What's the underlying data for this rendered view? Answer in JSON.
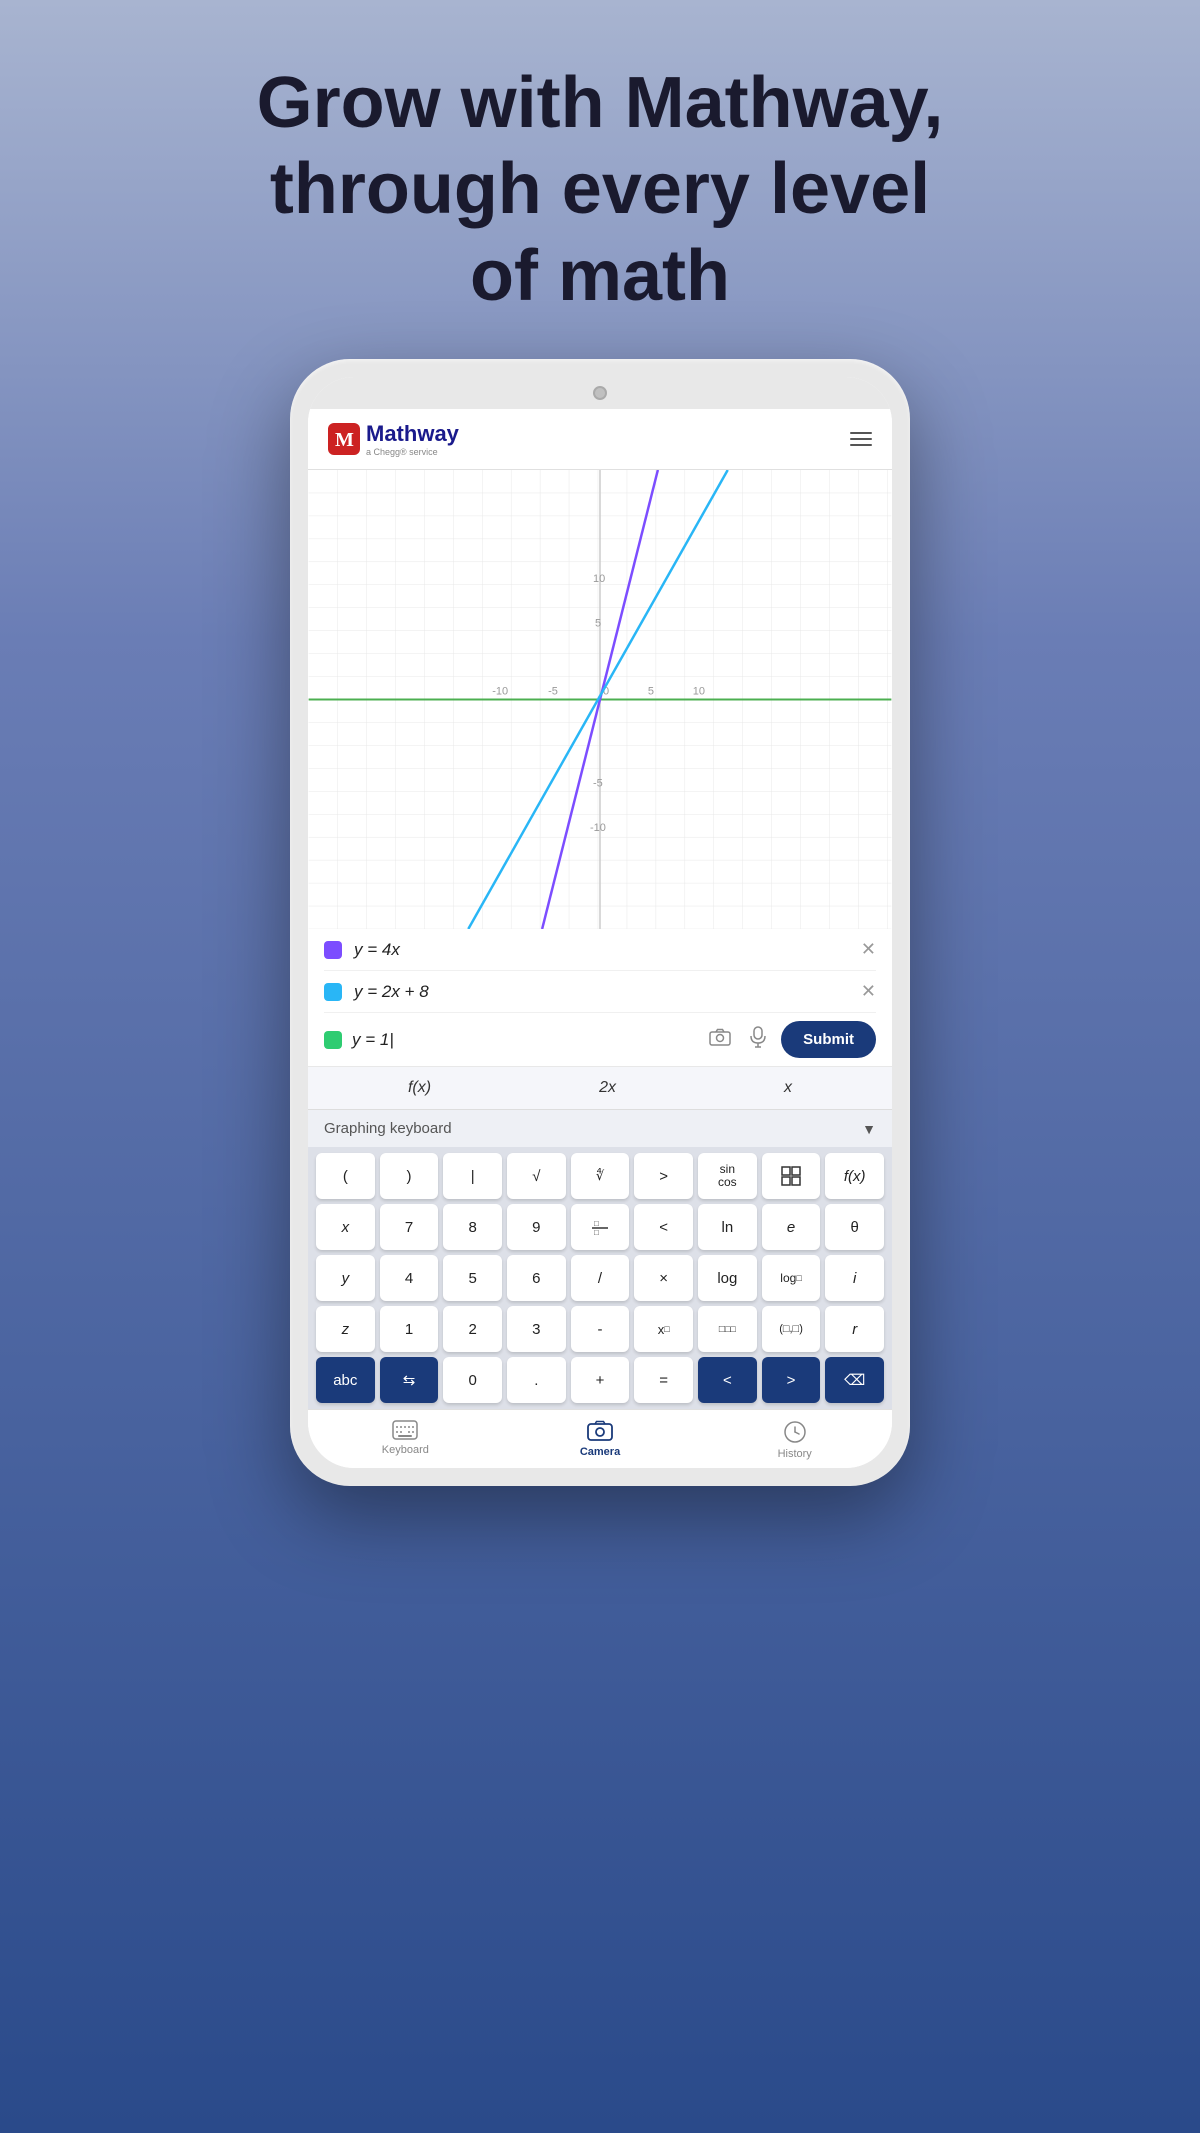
{
  "headline": {
    "line1": "Grow with Mathway,",
    "line2": "through every level",
    "line3": "of math"
  },
  "app": {
    "name": "Mathway",
    "subtitle": "a Chegg® service",
    "menu_icon": "hamburger-icon"
  },
  "equations": [
    {
      "id": 1,
      "color": "#7c4dff",
      "text": "y = 4x",
      "removable": true
    },
    {
      "id": 2,
      "color": "#29b6f6",
      "text": "y = 2x + 8",
      "removable": true
    },
    {
      "id": 3,
      "color": "#2ecc71",
      "text": "y = 1",
      "removable": false
    }
  ],
  "input": {
    "placeholder": "y = 1",
    "color": "#2ecc71"
  },
  "submit_button": "Submit",
  "quick_keys": [
    "f(x)",
    "2x",
    "x"
  ],
  "keyboard": {
    "label": "Graphing keyboard",
    "dropdown_icon": "chevron-down-icon",
    "rows": [
      [
        "(",
        ")",
        "|",
        "√",
        "∜",
        ">",
        "sin/cos",
        "grid",
        "f(x)"
      ],
      [
        "x",
        "7",
        "8",
        "9",
        "a/b",
        "<",
        "ln",
        "e",
        "θ"
      ],
      [
        "y",
        "4",
        "5",
        "6",
        "/",
        "×",
        "log",
        "log□",
        "i"
      ],
      [
        "z",
        "1",
        "2",
        "3",
        "-",
        "x□",
        "□□",
        "(□,□)",
        "r"
      ],
      [
        "abc",
        "⇆",
        "0",
        ".",
        "+",
        "=",
        "<",
        ">",
        "⌫"
      ]
    ]
  },
  "bottom_nav": [
    {
      "id": "keyboard",
      "label": "Keyboard",
      "icon": "keyboard-icon",
      "active": false
    },
    {
      "id": "camera",
      "label": "Camera",
      "icon": "camera-icon",
      "active": true
    },
    {
      "id": "history",
      "label": "History",
      "icon": "history-icon",
      "active": false
    }
  ]
}
